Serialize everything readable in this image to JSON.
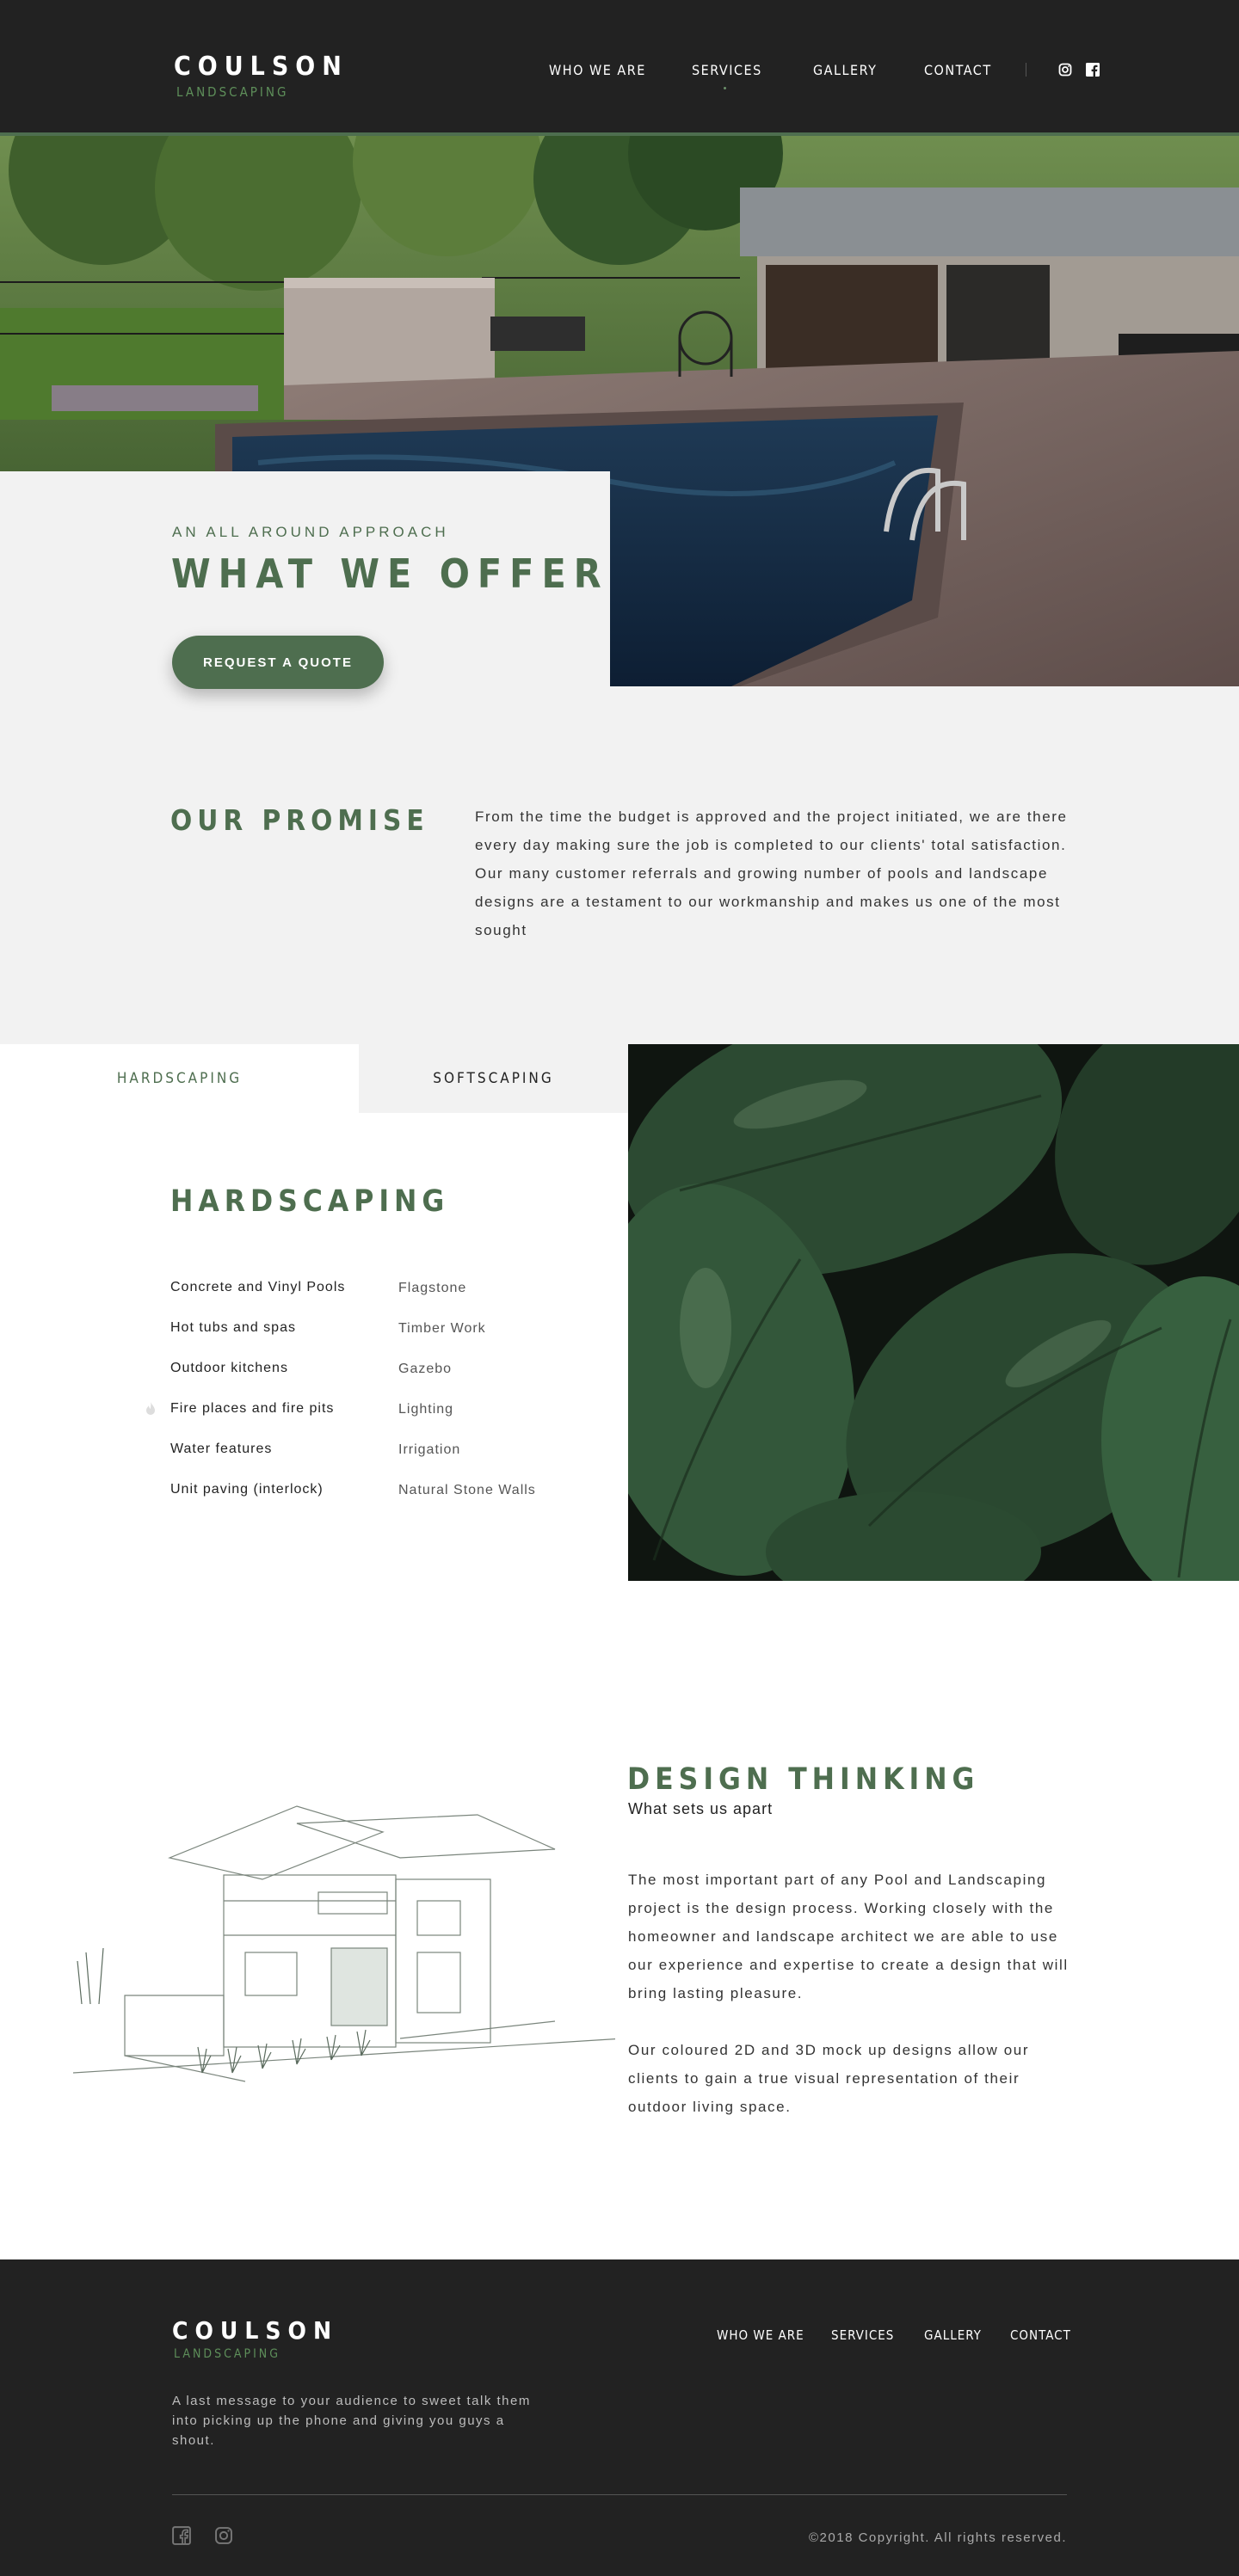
{
  "brand": {
    "name": "COULSON",
    "sub": "LANDSCAPING"
  },
  "nav": {
    "items": [
      {
        "label": "WHO WE ARE"
      },
      {
        "label": "SERVICES"
      },
      {
        "label": "GALLERY"
      },
      {
        "label": "CONTACT"
      }
    ],
    "social": [
      "instagram-icon",
      "facebook-icon"
    ]
  },
  "hero": {
    "kicker": "AN ALL AROUND APPROACH",
    "title": "WHAT WE OFFER",
    "cta": "REQUEST A QUOTE"
  },
  "promise": {
    "title": "OUR PROMISE",
    "text": "From the time the budget is approved and the project initiated, we are there every day making sure the job is completed to our clients' total satisfaction. Our many customer referrals and growing number of pools and landscape designs are a testament to our workmanship and makes us one of the most sought"
  },
  "services": {
    "tabs": [
      {
        "label": "HARDSCAPING",
        "active": true
      },
      {
        "label": "SOFTSCAPING",
        "active": false
      }
    ],
    "title": "HARDSCAPING",
    "col1": [
      "Concrete and Vinyl Pools",
      "Hot tubs and spas",
      "Outdoor kitchens",
      "Fire places and fire pits",
      "Water features",
      "Unit paving (interlock)"
    ],
    "col2": [
      "Flagstone",
      "Timber Work",
      "Gazebo",
      "Lighting",
      "Irrigation",
      "Natural Stone Walls"
    ]
  },
  "design": {
    "title": "DESIGN THINKING",
    "subtitle": "What sets us apart",
    "p1": "The most important part of any Pool and Landscaping project is the design process. Working closely with the homeowner and landscape architect we are able to use our experience and expertise to create a design that will bring lasting pleasure.",
    "p2": "Our coloured 2D and 3D mock up designs allow our clients to gain a true visual representation of their outdoor living space."
  },
  "footer": {
    "name": "COULSON",
    "sub": "LANDSCAPING",
    "message": "A last message to your audience to sweet talk them into picking up the phone and giving you guys a shout.",
    "nav": [
      "WHO WE ARE",
      "SERVICES",
      "GALLERY",
      "CONTACT"
    ],
    "social": [
      "facebook-icon",
      "instagram-icon"
    ],
    "copyright": "©2018 Copyright. All rights reserved."
  },
  "colors": {
    "brand_green": "#4e6e4f",
    "logo_green": "#5e8f5a",
    "dark": "#222222",
    "light_bg": "#f2f2f2"
  }
}
